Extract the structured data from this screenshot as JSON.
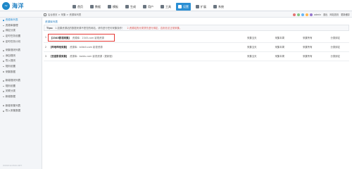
{
  "header": {
    "logo_text": "海洋",
    "nav": [
      "首页",
      "数据",
      "模板",
      "生成",
      "用户",
      "工具",
      "设置",
      "扩展",
      "系统"
    ],
    "active_nav_index": 6
  },
  "subbar": {
    "breadcrumb": "后台首页 > 采集 > 资源库列表",
    "admin": "admin",
    "logout": "退出",
    "website": "网站首页",
    "clear_cache": "更新缓存"
  },
  "sidebar": {
    "groups": [
      [
        "资源库列表",
        "资源库管理",
        "绑定分类",
        "定时任务设置",
        "定时任务计划"
      ],
      [
        "采集规则列表",
        "添加规则",
        "导入规则",
        "规则设置",
        "采集数据"
      ],
      [
        "新增规则列表",
        "规则设置",
        "关联分类",
        "新增数据"
      ],
      [
        "新增采集列表",
        "导入采集数据"
      ]
    ],
    "active_item": "资源库列表",
    "watermark": "WWW.SOHOK.NET"
  },
  "main": {
    "panel_title": "资源库列表",
    "tips_label": "Tips:",
    "tips_text": "1.如果资源站的数据来源不是您的网站，请勿进行任何采集操作！",
    "tips_red": "2.资源站的分类须先进行绑定，否则无法正常采集。",
    "rows": [
      {
        "num": "1",
        "name": "【2345影视采集】",
        "note": "资源库：2345.com  影视资源",
        "actions": [
          "采集当天",
          "采集本周",
          "采集所有",
          "分类绑定"
        ],
        "highlight": true
      },
      {
        "num": "2",
        "name": "【哔哩哔哩采集】",
        "note": "资源库：bilibili.com  影视资源",
        "actions": [
          "采集当天",
          "采集本周",
          "采集所有",
          "分类绑定"
        ],
        "highlight": false
      },
      {
        "num": "3",
        "name": "【百度影视采集】",
        "note": "资源库：baidu.com  影视资源（更新慢）",
        "actions": [
          "采集当天",
          "采集本周",
          "采集所有",
          "分类绑定"
        ],
        "highlight": false
      }
    ]
  },
  "colors": {
    "accent": "#2a8fd4",
    "highlight_border": "#e53935"
  }
}
